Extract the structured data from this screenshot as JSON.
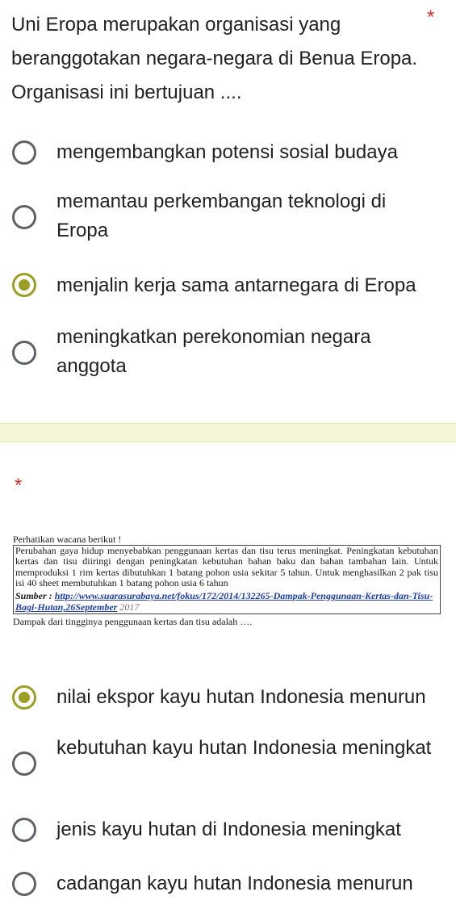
{
  "question1": {
    "text": "Uni Eropa merupakan organisasi yang beranggotakan negara-negara di Benua Eropa. Organisasi ini bertujuan ....",
    "required_mark": "*",
    "options": [
      {
        "label": "mengembangkan potensi sosial budaya",
        "selected": false
      },
      {
        "label": "memantau perkembangan teknologi di Eropa",
        "selected": false
      },
      {
        "label": "menjalin kerja sama antarnegara di Eropa",
        "selected": true
      },
      {
        "label": "meningkatkan perekonomian negara anggota",
        "selected": false
      }
    ]
  },
  "question2": {
    "required_mark": "*",
    "passage": {
      "intro": "Perhatikan wacana berikut !",
      "body": "Perubahan gaya hidup menyebabkan penggunaan kertas dan tisu terus meningkat. Peningkatan kebutuhan kertas dan tisu diiringi dengan peningkatan kebutuhan bahan baku dan bahan tambahan lain. Untuk memproduksi 1 rim kertas dibutuhkan 1 batang pohon usia sekitar 5 tahun. Untuk menghasilkan 2 pak tisu isi 40 sheet membutuhkan 1 batang pohon usia 6 tahun",
      "source_label": "Sumber :",
      "source_url": "http://www.suarasurabaya.net/fokus/172/2014/132265-Dampak-Penggunaan-Kertas-dan-Tisu-Bagi-Hutan,26September",
      "source_year": "2017",
      "question": "Dampak dari tingginya penggunaan kertas dan tisu adalah …."
    },
    "options": [
      {
        "label": "nilai ekspor kayu hutan Indonesia menurun",
        "selected": true
      },
      {
        "label": "kebutuhan kayu hutan Indonesia meningkat",
        "selected": false
      },
      {
        "label": "jenis kayu hutan di Indonesia meningkat",
        "selected": false
      },
      {
        "label": "cadangan kayu hutan Indonesia menurun",
        "selected": false
      }
    ]
  },
  "colors": {
    "accent": "#9e9d24",
    "required": "#d93025",
    "divider_band": "#f4f4d6",
    "link": "#1f3fa6"
  }
}
